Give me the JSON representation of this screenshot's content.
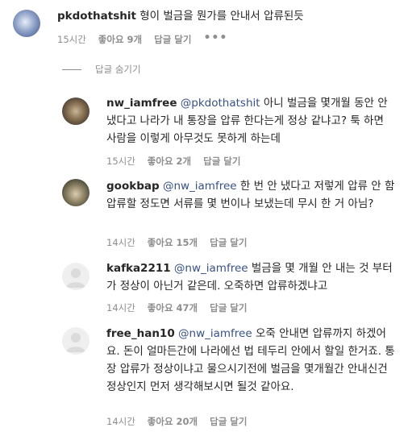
{
  "top": {
    "username": "pkdothatshit",
    "text": "형이 벌금을 뭔가를 안내서 압류된듯",
    "time": "15시간",
    "likes": "좋아요 9개",
    "reply": "답글 달기",
    "more": "•••"
  },
  "hide_replies": "답글 숨기기",
  "replies": [
    {
      "username": "nw_iamfree",
      "mention": "@pkdothatshit",
      "text": "아니 벌금을 몇개월 동안 안냈다고 나라가 내 통장을 압류 한다는게 정상 같냐고? 툭 하면 사람을 이렇게 아무것도 못하게 하는데",
      "time": "15시간",
      "likes": "좋아요 2개",
      "reply": "답글 달기"
    },
    {
      "username": "gookbap",
      "mention": "@nw_iamfree",
      "text": "한 번 안 냈다고 저렇게 압류 안 함 압류할 정도면 서류를 몇 번이나 보냈는데 무시 한 거 아님?",
      "time": "14시간",
      "likes": "좋아요 15개",
      "reply": "답글 달기"
    },
    {
      "username": "kafka2211",
      "mention": "@nw_iamfree",
      "text": "벌금을 몇 개월 안 내는 것 부터가 정상이 아닌거 같은데. 오죽하면 압류하겠냐고",
      "time": "14시간",
      "likes": "좋아요 47개",
      "reply": "답글 달기"
    },
    {
      "username": "free_han10",
      "mention": "@nw_iamfree",
      "text": "오죽 안내면 압류까지 하겠어요. 돈이 얼마든간에 나라에선 법 테두리 안에서 할일 한거죠. 통장 압류가 정상이냐고 물으시기전에 벌금을 몇개월간 안내신건 정상인지 먼저 생각해보시면 될것 같아요.",
      "time": "14시간",
      "likes": "좋아요 20개",
      "reply": "답글 달기"
    }
  ]
}
